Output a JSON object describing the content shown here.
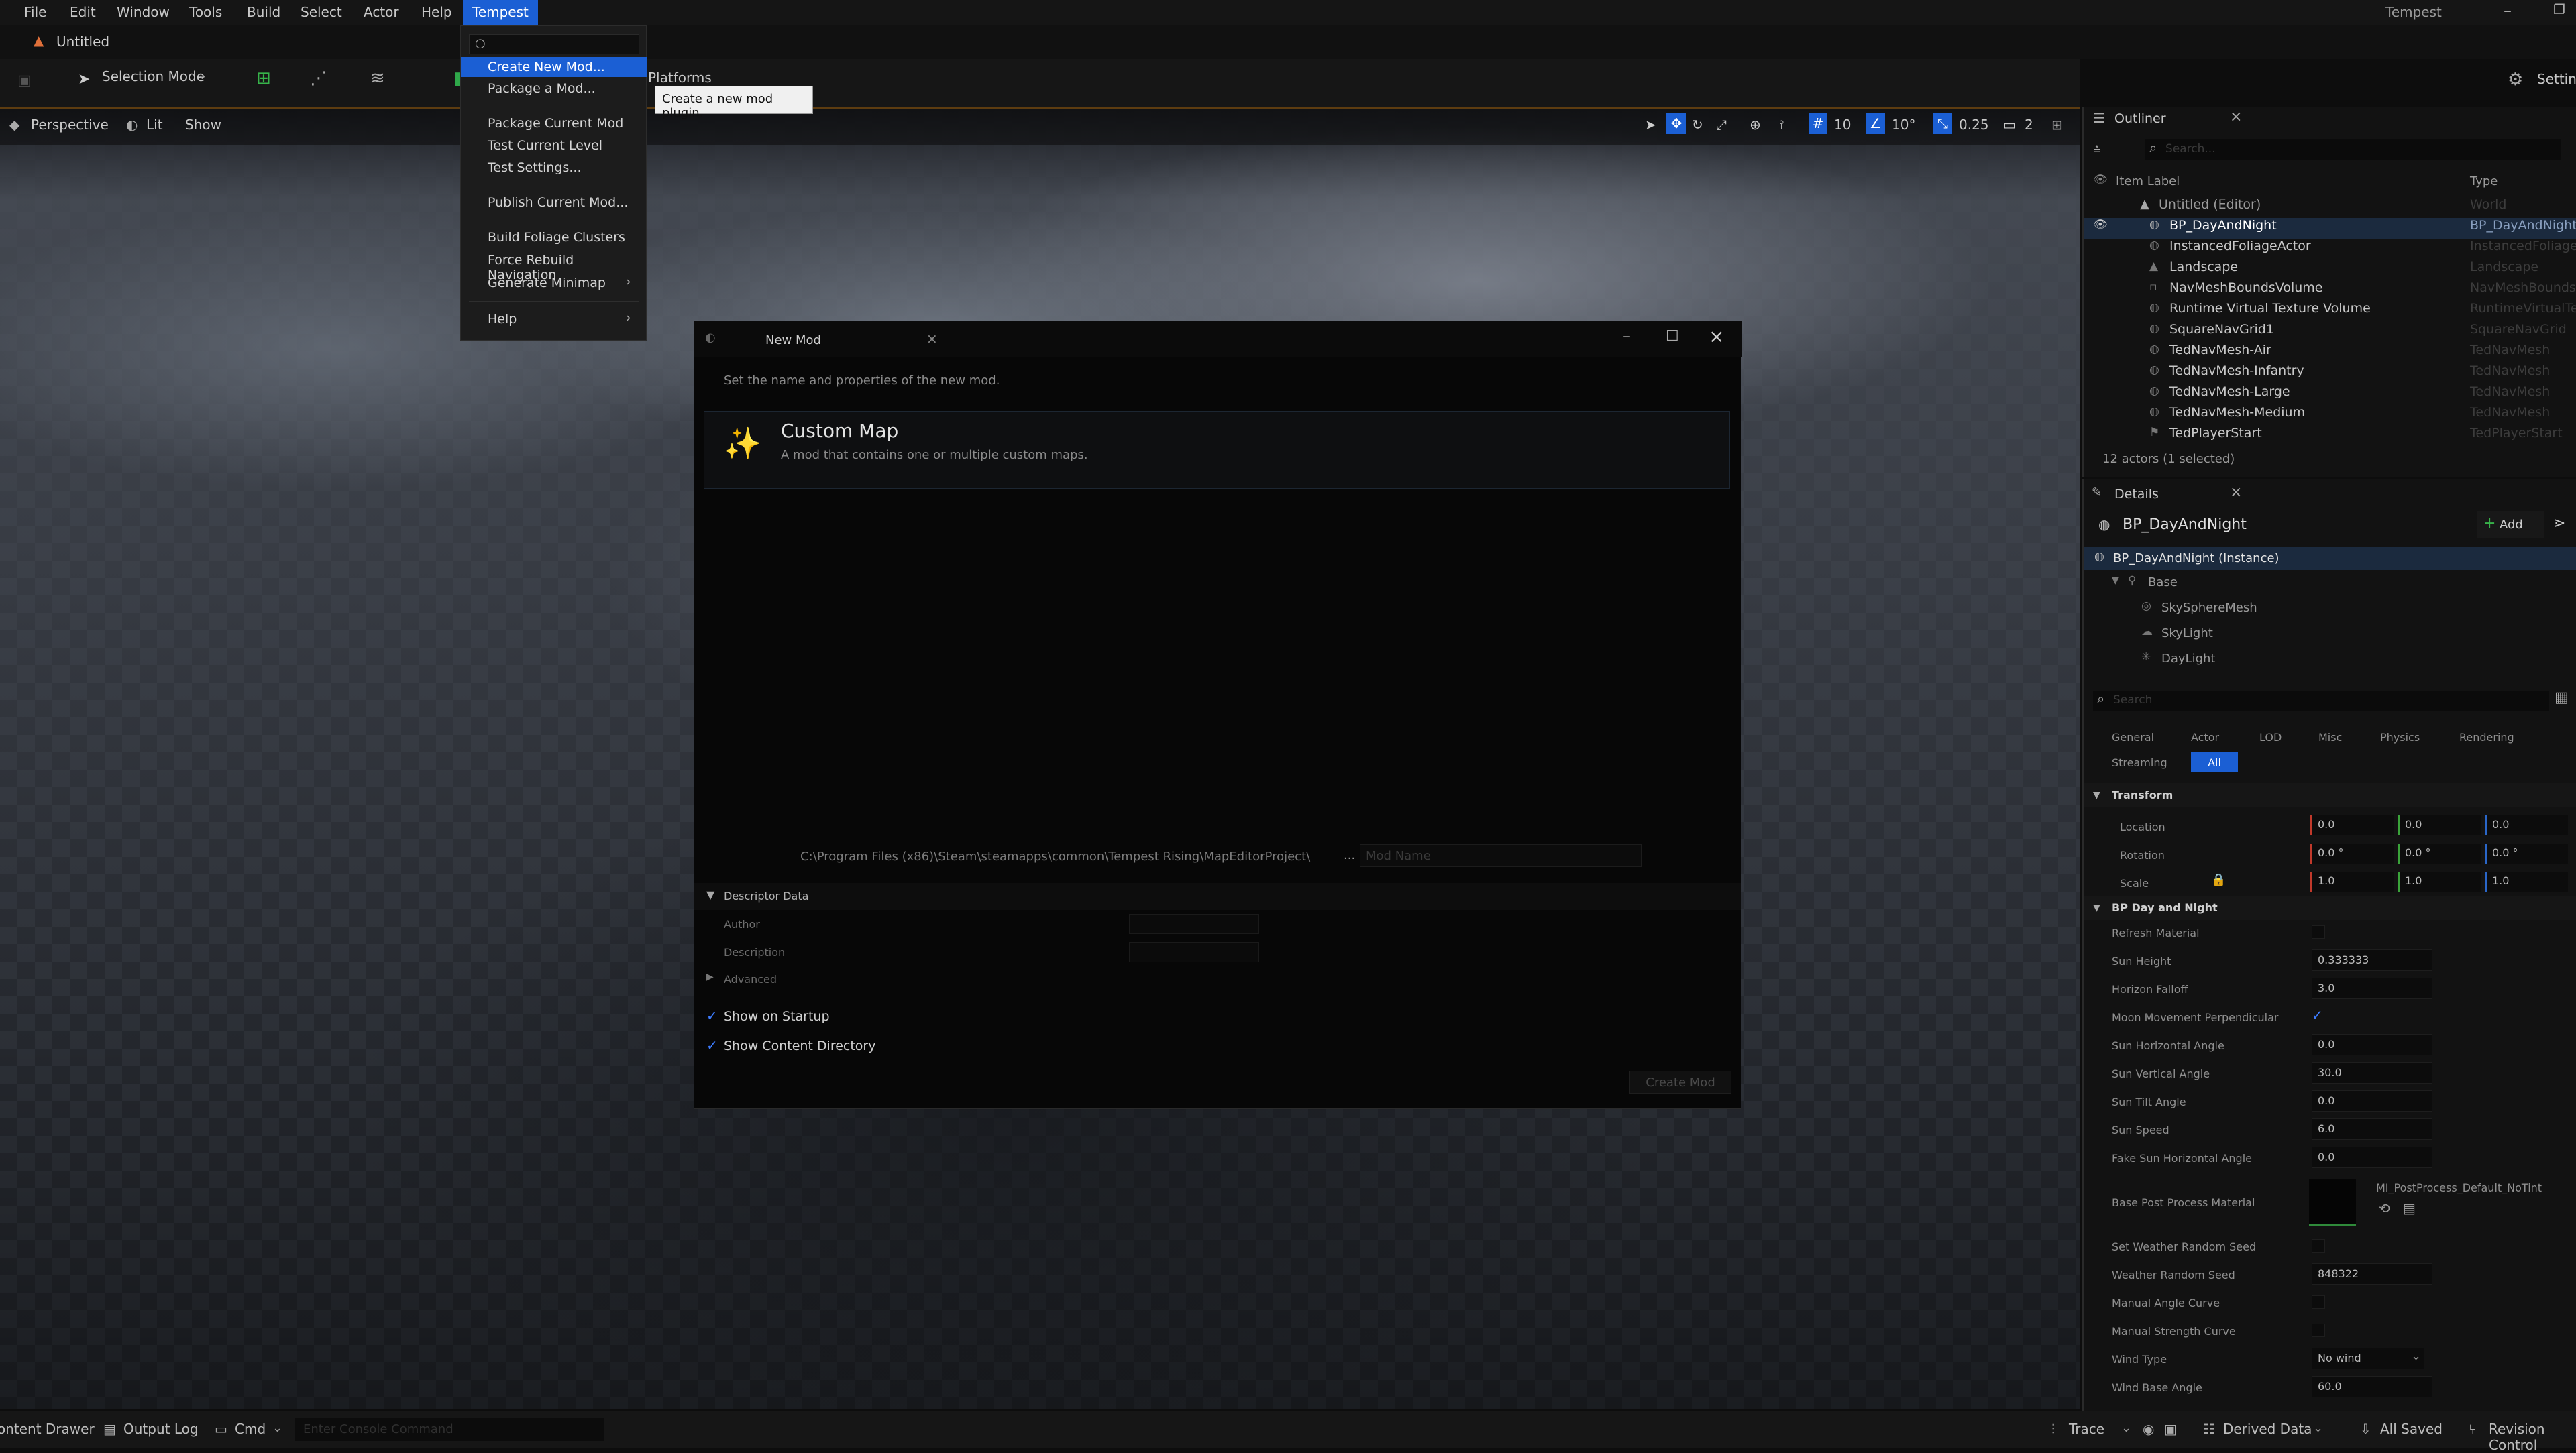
{
  "app": {
    "menu": [
      "File",
      "Edit",
      "Window",
      "Tools",
      "Build",
      "Select",
      "Actor",
      "Help",
      "Tempest"
    ],
    "window_title": "Tempest",
    "document_tab": "Untitled"
  },
  "toolbar": {
    "selection_mode": "Selection Mode",
    "platforms": "Platforms"
  },
  "viewport": {
    "perspective": "Perspective",
    "lit": "Lit",
    "show": "Show",
    "grid_snap": "10",
    "rotation_snap": "10°",
    "scale_snap": "0.25",
    "camera_speed": "2"
  },
  "tempest_menu": {
    "search_placeholder": "",
    "items": [
      "Create New Mod...",
      "Package a Mod...",
      "Package Current Mod",
      "Test Current Level",
      "Test Settings...",
      "Publish Current Mod...",
      "Build Foliage Clusters",
      "Force Rebuild Navigation",
      "Generate Minimap",
      "Help"
    ],
    "tooltip": "Create a new mod plugin."
  },
  "new_mod": {
    "title": "New Mod",
    "subtitle": "Set the name and properties of the new mod.",
    "template_title": "Custom Map",
    "template_desc": "A mod that contains one or multiple custom maps.",
    "path": "C:\\Program Files (x86)\\Steam\\steamapps\\common\\Tempest Rising\\MapEditorProject\\",
    "browse": "...",
    "name_placeholder": "Mod Name",
    "descriptor_header": "Descriptor Data",
    "author_label": "Author",
    "description_label": "Description",
    "advanced_label": "Advanced",
    "show_on_startup": "Show on Startup",
    "show_content_dir": "Show Content Directory",
    "create_button": "Create Mod"
  },
  "outliner": {
    "title": "Outliner",
    "settings": "Settings",
    "search_placeholder": "Search...",
    "col_label": "Item Label",
    "col_type": "Type",
    "rows": [
      {
        "name": "Untitled (Editor)",
        "type": "World"
      },
      {
        "name": "BP_DayAndNight",
        "type": "BP_DayAndNight_"
      },
      {
        "name": "InstancedFoliageActor",
        "type": "InstancedFoliage"
      },
      {
        "name": "Landscape",
        "type": "Landscape"
      },
      {
        "name": "NavMeshBoundsVolume",
        "type": "NavMeshBoundsV"
      },
      {
        "name": "Runtime Virtual Texture Volume",
        "type": "RuntimeVirtualTex"
      },
      {
        "name": "SquareNavGrid1",
        "type": "SquareNavGrid"
      },
      {
        "name": "TedNavMesh-Air",
        "type": "TedNavMesh"
      },
      {
        "name": "TedNavMesh-Infantry",
        "type": "TedNavMesh"
      },
      {
        "name": "TedNavMesh-Large",
        "type": "TedNavMesh"
      },
      {
        "name": "TedNavMesh-Medium",
        "type": "TedNavMesh"
      },
      {
        "name": "TedPlayerStart",
        "type": "TedPlayerStart"
      }
    ],
    "count": "12 actors (1 selected)"
  },
  "details": {
    "title": "Details",
    "actor_name": "BP_DayAndNight",
    "add_button": "Add",
    "instance": "BP_DayAndNight (Instance)",
    "components": [
      "Base",
      "SkySphereMesh",
      "SkyLight",
      "DayLight"
    ],
    "search_placeholder": "Search",
    "tabs": [
      "General",
      "Actor",
      "LOD",
      "Misc",
      "Physics",
      "Rendering",
      "Streaming",
      "All"
    ],
    "transform_header": "Transform",
    "location": {
      "label": "Location",
      "x": "0.0",
      "y": "0.0",
      "z": "0.0"
    },
    "rotation": {
      "label": "Rotation",
      "x": "0.0 °",
      "y": "0.0 °",
      "z": "0.0 °"
    },
    "scale": {
      "label": "Scale",
      "x": "1.0",
      "y": "1.0",
      "z": "1.0"
    },
    "bp_header": "BP Day and Night",
    "refresh_material": "Refresh Material",
    "sun_height": {
      "label": "Sun Height",
      "value": "0.333333"
    },
    "horizon_falloff": {
      "label": "Horizon Falloff",
      "value": "3.0"
    },
    "moon_perp": "Moon Movement Perpendicular",
    "sun_h_angle": {
      "label": "Sun Horizontal Angle",
      "value": "0.0"
    },
    "sun_v_angle": {
      "label": "Sun Vertical Angle",
      "value": "30.0"
    },
    "sun_tilt": {
      "label": "Sun Tilt Angle",
      "value": "0.0"
    },
    "sun_speed": {
      "label": "Sun Speed",
      "value": "6.0"
    },
    "fake_sun": {
      "label": "Fake Sun Horizontal Angle",
      "value": "0.0"
    },
    "bpp_material": {
      "label": "Base Post Process Material",
      "value": "MI_PostProcess_Default_NoTint"
    },
    "set_weather_seed": "Set Weather Random Seed",
    "weather_seed": {
      "label": "Weather Random Seed",
      "value": "848322"
    },
    "manual_angle": "Manual Angle Curve",
    "manual_strength": "Manual Strength Curve",
    "wind_type": {
      "label": "Wind Type",
      "value": "No wind"
    },
    "wind_base_angle": {
      "label": "Wind Base Angle",
      "value": "60.0"
    }
  },
  "statusbar": {
    "content_drawer": "Content Drawer",
    "output_log": "Output Log",
    "cmd": "Cmd",
    "console_placeholder": "Enter Console Command",
    "trace": "Trace",
    "derived_data": "Derived Data",
    "all_saved": "All Saved",
    "revision_control": "Revision Control"
  },
  "colors": {
    "accent": "#1b5fd4",
    "selection": "#1b2a3e",
    "check": "#3d7cff",
    "viewport_border": "#c47a1a"
  }
}
